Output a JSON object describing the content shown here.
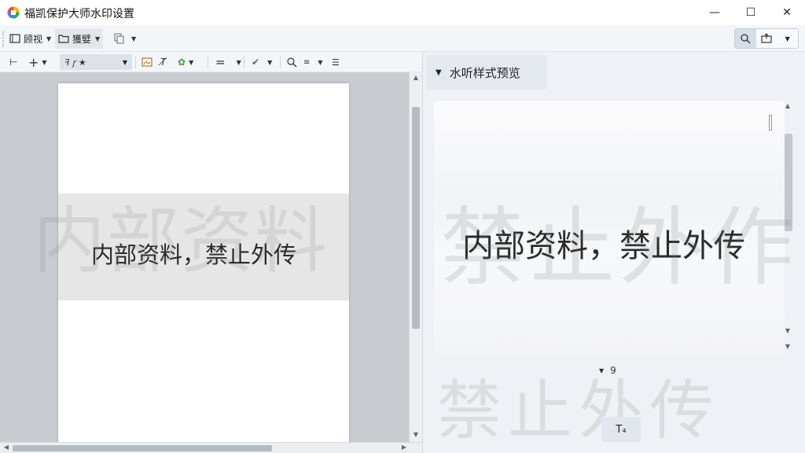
{
  "window": {
    "title": "福凯保护大师水印设置",
    "minimize_label": "—",
    "maximize_label": "☐",
    "close_label": "✕"
  },
  "toolbar": {
    "view_label": "顾视",
    "browse_label": "獲嬖",
    "layout_caret": "▾"
  },
  "toolbar2": {
    "font_sample": "ꟻ ꞅ ★",
    "equal_label": "=",
    "menu_label": "☰"
  },
  "document": {
    "watermark_text": "内部资料，禁止外传",
    "background_watermark": "内部资料"
  },
  "preview_panel": {
    "header": "水听样式预览",
    "preview_text": "内部资料，禁止外传",
    "background_watermark": "禁止外传",
    "background_watermark_row1": "禁止外作",
    "font_size_value": "9",
    "text_tool_label": "T₄"
  },
  "colors": {
    "page": "#ffffff",
    "doc_background": "#c9cdd2",
    "panel_background": "#eef1f5",
    "title_text": "#111111"
  }
}
